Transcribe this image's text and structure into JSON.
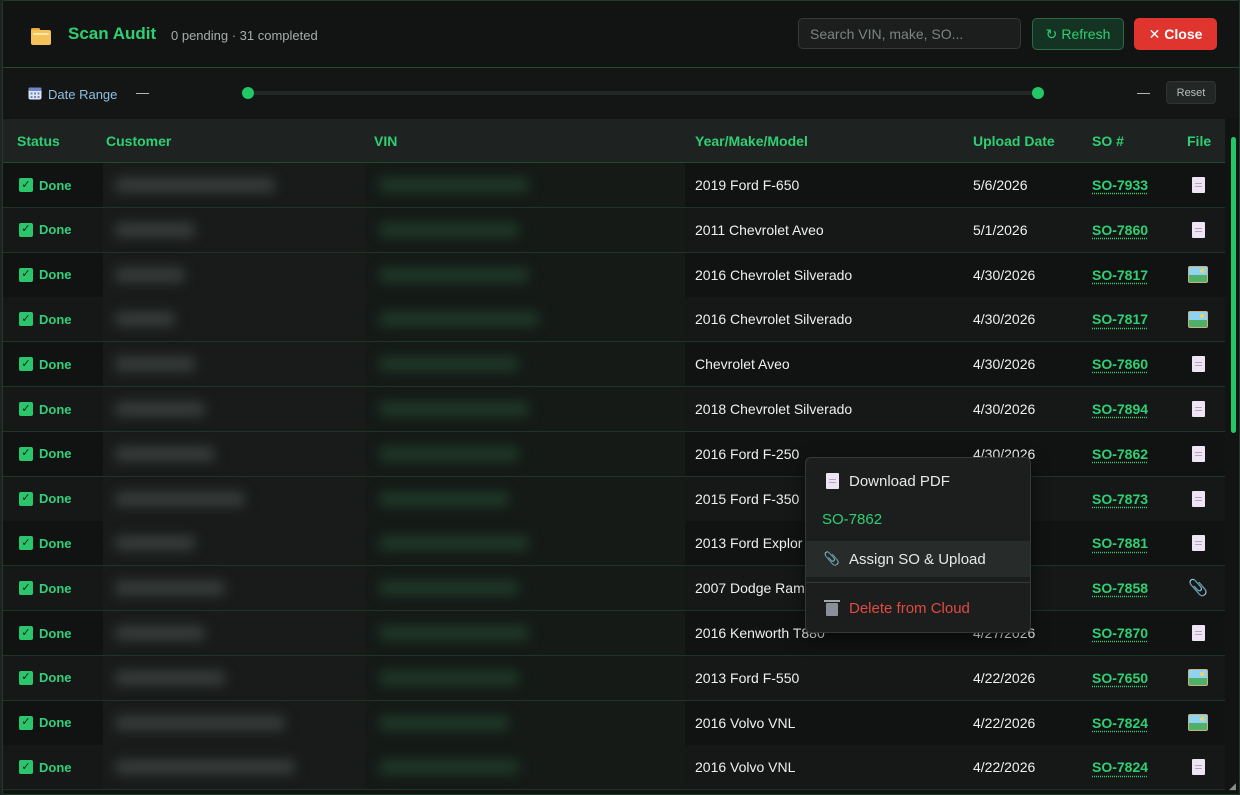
{
  "header": {
    "title": "Scan Audit",
    "subtitle": "0 pending · 31 completed",
    "search_placeholder": "Search VIN, make, SO...",
    "refresh_label": "Refresh",
    "close_label": "Close",
    "refresh_icon": "↻",
    "close_icon": "✕"
  },
  "date_range": {
    "label": "Date Range",
    "start_value": "—",
    "end_value": "—",
    "reset_label": "Reset",
    "range_start_fraction": 0.0,
    "range_end_fraction": 1.0
  },
  "table": {
    "columns": [
      "Status",
      "Customer",
      "VIN",
      "Year/Make/Model",
      "Upload Date",
      "SO #",
      "File"
    ],
    "rows": [
      {
        "status": "Done",
        "ymm": "2019 Ford F-650",
        "date": "5/6/2026",
        "so": "SO-7933",
        "file": "doc-icon"
      },
      {
        "status": "Done",
        "ymm": "2011 Chevrolet Aveo",
        "date": "5/1/2026",
        "so": "SO-7860",
        "file": "doc-icon"
      },
      {
        "status": "Done",
        "ymm": "2016 Chevrolet Silverado",
        "date": "4/30/2026",
        "so": "SO-7817",
        "file": "image-icon"
      },
      {
        "status": "Done",
        "ymm": "2016 Chevrolet Silverado",
        "date": "4/30/2026",
        "so": "SO-7817",
        "file": "image-icon"
      },
      {
        "status": "Done",
        "ymm": "Chevrolet Aveo",
        "date": "4/30/2026",
        "so": "SO-7860",
        "file": "doc-icon"
      },
      {
        "status": "Done",
        "ymm": "2018 Chevrolet Silverado",
        "date": "4/30/2026",
        "so": "SO-7894",
        "file": "doc-icon"
      },
      {
        "status": "Done",
        "ymm": "2016 Ford F-250",
        "date": "4/30/2026",
        "so": "SO-7862",
        "file": "doc-icon"
      },
      {
        "status": "Done",
        "ymm": "2015 Ford F-350",
        "date": "",
        "so": "SO-7873",
        "file": "doc-icon"
      },
      {
        "status": "Done",
        "ymm": "2013 Ford Explor",
        "date": "",
        "so": "SO-7881",
        "file": "doc-icon"
      },
      {
        "status": "Done",
        "ymm": "2007 Dodge Ram",
        "date": "",
        "so": "SO-7858",
        "file": "paperclip-icon"
      },
      {
        "status": "Done",
        "ymm": "2016 Kenworth T880",
        "date": "4/27/2026",
        "so": "SO-7870",
        "file": "doc-icon"
      },
      {
        "status": "Done",
        "ymm": "2013 Ford F-550",
        "date": "4/22/2026",
        "so": "SO-7650",
        "file": "image-icon"
      },
      {
        "status": "Done",
        "ymm": "2016 Volvo VNL",
        "date": "4/22/2026",
        "so": "SO-7824",
        "file": "image-icon"
      },
      {
        "status": "Done",
        "ymm": "2016 Volvo VNL",
        "date": "4/22/2026",
        "so": "SO-7824",
        "file": "doc-icon"
      }
    ]
  },
  "context_menu": {
    "items": [
      {
        "label": "Download PDF",
        "icon": "doc-icon",
        "color": "#e6e9e7"
      },
      {
        "label": "SO-7862",
        "icon": "",
        "color": "#2fcf73"
      },
      {
        "label": "Assign SO & Upload",
        "icon": "paperclip-icon",
        "color": "#e6e9e7"
      },
      {
        "label": "Delete from Cloud",
        "icon": "trash-icon",
        "color": "#e24a43"
      }
    ]
  },
  "colors": {
    "accent": "#2fcf73",
    "danger": "#e0342f",
    "background": "#121413"
  }
}
